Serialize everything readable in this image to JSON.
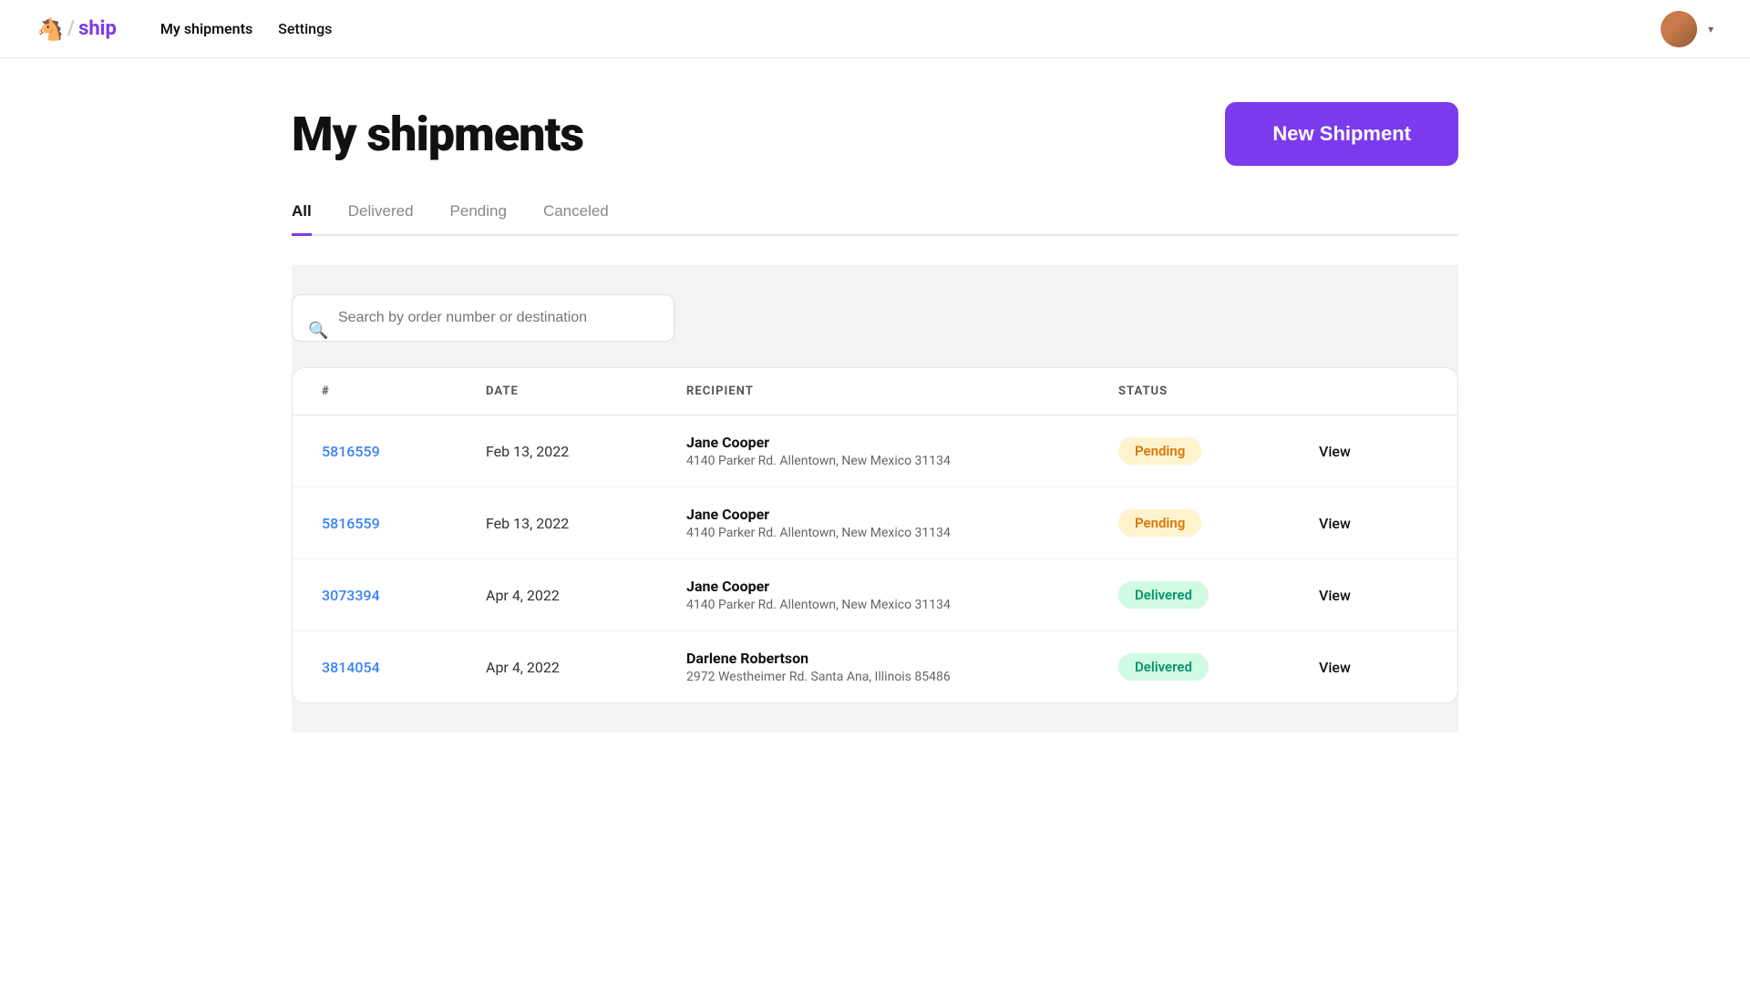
{
  "app": {
    "logo_horse": "🐎",
    "logo_text": "ship",
    "logo_slash": "/"
  },
  "nav": {
    "links": [
      {
        "label": "My shipments",
        "active": true
      },
      {
        "label": "Settings",
        "active": false
      }
    ],
    "avatar_text": "👤"
  },
  "header": {
    "title": "My shipments",
    "new_shipment_label": "New Shipment"
  },
  "tabs": [
    {
      "label": "All",
      "active": true
    },
    {
      "label": "Delivered",
      "active": false
    },
    {
      "label": "Pending",
      "active": false
    },
    {
      "label": "Canceled",
      "active": false
    }
  ],
  "search": {
    "placeholder": "Search by order number or destination"
  },
  "table": {
    "columns": [
      "#",
      "DATE",
      "RECIPIENT",
      "STATUS",
      ""
    ],
    "rows": [
      {
        "order": "5816559",
        "date": "Feb 13, 2022",
        "recipient_name": "Jane Cooper",
        "recipient_address": "4140 Parker Rd. Allentown, New Mexico 31134",
        "status": "Pending",
        "status_type": "pending",
        "view": "View"
      },
      {
        "order": "5816559",
        "date": "Feb 13, 2022",
        "recipient_name": "Jane Cooper",
        "recipient_address": "4140 Parker Rd. Allentown, New Mexico 31134",
        "status": "Pending",
        "status_type": "pending",
        "view": "View"
      },
      {
        "order": "3073394",
        "date": "Apr 4, 2022",
        "recipient_name": "Jane Cooper",
        "recipient_address": "4140 Parker Rd. Allentown, New Mexico 31134",
        "status": "Delivered",
        "status_type": "delivered",
        "view": "View"
      },
      {
        "order": "3814054",
        "date": "Apr 4, 2022",
        "recipient_name": "Darlene Robertson",
        "recipient_address": "2972 Westheimer Rd. Santa Ana, Illinois 85486",
        "status": "Delivered",
        "status_type": "delivered",
        "view": "View"
      }
    ]
  },
  "colors": {
    "accent": "#7c3aed",
    "pending_bg": "#fef3cd",
    "pending_text": "#d97706",
    "delivered_bg": "#d1fae5",
    "delivered_text": "#059669"
  }
}
